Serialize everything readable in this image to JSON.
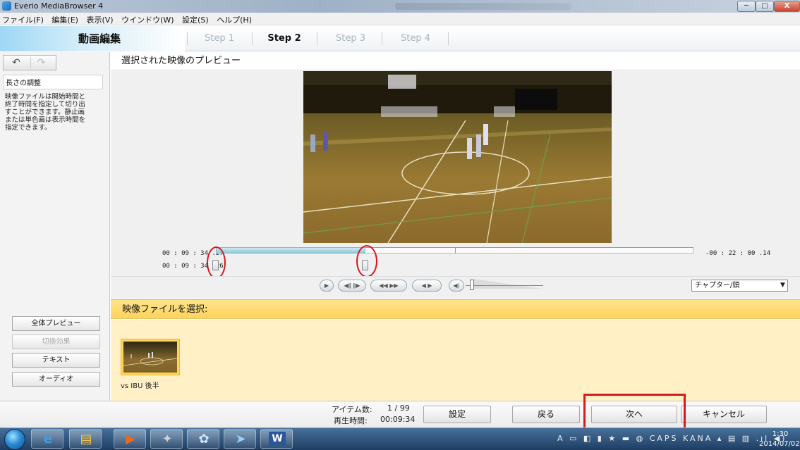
{
  "window": {
    "title": "Everio MediaBrowser 4",
    "controls": {
      "minimize": "─",
      "maximize": "□",
      "close": "X"
    }
  },
  "menu": [
    "ファイル(F)",
    "編集(E)",
    "表示(V)",
    "ウインドウ(W)",
    "設定(S)",
    "ヘルプ(H)"
  ],
  "steps": {
    "mode_title": "動画編集",
    "items": [
      "Step 1",
      "Step 2",
      "Step 3",
      "Step 4"
    ],
    "active_index": 1
  },
  "left_panel": {
    "undo_icon": "undo-arrow-icon",
    "redo_icon": "redo-arrow-icon",
    "undo_glyph": "↶",
    "redo_glyph": "↷",
    "help_heading": "長さの調整",
    "help_text": "映像ファイルは開始時間と終了時間を指定して切り出すことができます。静止画または単色画は表示時間を指定できます。",
    "buttons": [
      {
        "label": "全体プレビュー",
        "enabled": true
      },
      {
        "label": "切換効果",
        "enabled": false
      },
      {
        "label": "テキスト",
        "enabled": true
      },
      {
        "label": "オーディオ",
        "enabled": true
      }
    ]
  },
  "preview": {
    "header": "選択された映像のプレビュー",
    "timecode_in": "00 : 09 : 34 .27",
    "timecode_out": "00 : 09 : 34 .26",
    "timecode_remaining": "-00 : 22 : 00 .14",
    "trim_fill_fraction": 0.31
  },
  "playback": {
    "buttons": [
      {
        "name": "play-icon",
        "glyph": "▶"
      },
      {
        "name": "frame-step-icon",
        "glyph": "◀ǁ ǁ▶"
      },
      {
        "name": "skip-icon",
        "glyph": "◀◀ ▶▶"
      },
      {
        "name": "chapter-skip-icon",
        "glyph": "◀ ▶"
      },
      {
        "name": "volume-icon",
        "glyph": "◀)"
      }
    ],
    "chapter_select": {
      "value": "チャプター/頭",
      "arrow": "▼"
    }
  },
  "file_select": {
    "header": "映像ファイルを選択:",
    "items": [
      {
        "label": "vs IBU 後半"
      }
    ]
  },
  "status": {
    "items_label": "アイテム数:",
    "items_value": "1 / 99",
    "time_label": "再生時間:",
    "time_value": "00:09:34"
  },
  "actions": {
    "settings": "設定",
    "back": "戻る",
    "next": "次へ",
    "cancel": "キャンセル"
  },
  "taskbar": {
    "apps": [
      {
        "name": "ie-icon",
        "glyph": "e",
        "color": "#3aa0e8"
      },
      {
        "name": "explorer-icon",
        "glyph": "▤",
        "color": "#f2c14e"
      },
      {
        "name": "media-icon",
        "glyph": "▶",
        "color": "#e86a1a"
      },
      {
        "name": "camera-icon",
        "glyph": "✦",
        "color": "#d0d0d0"
      },
      {
        "name": "paint-icon",
        "glyph": "✿",
        "color": "#cfe6ff"
      },
      {
        "name": "mediabrowser-icon",
        "glyph": "➤",
        "color": "#8fd2ff"
      },
      {
        "name": "word-icon",
        "glyph": "W",
        "color": "#2b579a"
      }
    ],
    "tray_text": "A ▭ ◧ ▮ ★ ▬ ◍ CAPS KANA ▴ ▤ ▥ .ıl ◀)",
    "clock_time": "1:30",
    "clock_date": "2014/07/02"
  }
}
